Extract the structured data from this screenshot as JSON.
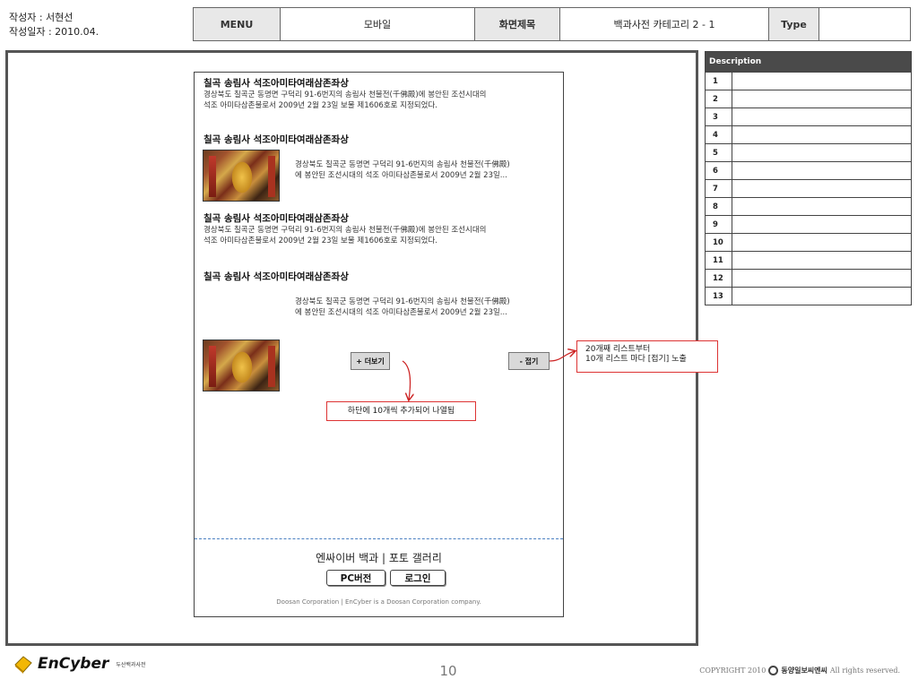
{
  "meta": {
    "author_line": "작성자 : 서현선",
    "date_line": "작성일자 : 2010.04."
  },
  "header": {
    "menu_label": "MENU",
    "menu_value": "모바일",
    "screen_title_label": "화면제목",
    "screen_title_value": "백과사전 카테고리 2 - 1",
    "type_label": "Type",
    "type_value": ""
  },
  "list": {
    "items": [
      {
        "title": "칠곡 송림사 석조아미타여래삼존좌상",
        "desc_line1": "경상북도 칠곡군 동명면 구덕리 91-6번지의 송림사 천불전(千佛殿)에 봉안된 조선시대의",
        "desc_line2": "석조 아미타삼존불로서 2009년 2월 23일 보물 제1606호로 지정되었다."
      },
      {
        "title": "칠곡 송림사 석조아미타여래삼존좌상",
        "desc_line1": "경상북도 칠곡군 동명면 구덕리 91-6번지의 송림사 천불전(千佛殿)",
        "desc_line2": "에 봉안된 조선시대의 석조 아미타삼존불로서 2009년 2월 23일..."
      },
      {
        "title": "칠곡 송림사 석조아미타여래삼존좌상",
        "desc_line1": "경상북도 칠곡군 동명면 구덕리 91-6번지의 송림사 천불전(千佛殿)에 봉안된 조선시대의",
        "desc_line2": "석조 아미타삼존불로서 2009년 2월 23일 보물 제1606호로 지정되었다."
      },
      {
        "title": "칠곡 송림사 석조아미타여래삼존좌상",
        "desc_line1": "경상북도 칠곡군 동명면 구덕리 91-6번지의 송림사 천불전(千佛殿)",
        "desc_line2": "에 봉안된 조선시대의 석조 아미타삼존불로서 2009년 2월 23일..."
      }
    ],
    "more_button": "+ 더보기",
    "fold_button": "- 접기"
  },
  "annotations": {
    "more_note": "하단에 10개씩 추가되어 나열됨",
    "fold_note_line1": "20개째 리스트부터",
    "fold_note_line2": "10개 리스트 마다 [접기] 노출"
  },
  "footer": {
    "links": "엔싸이버 백과 | 포토 갤러리",
    "pc_button": "PC버전",
    "login_button": "로그인",
    "company": "Doosan Corporation | EnCyber is a Doosan Corporation company."
  },
  "description": {
    "heading": "Description",
    "rows": [
      "1",
      "2",
      "3",
      "4",
      "5",
      "6",
      "7",
      "8",
      "9",
      "10",
      "11",
      "12",
      "13"
    ]
  },
  "bottom": {
    "brand": "EnCyber",
    "brand_sub": "두산백과사전",
    "page_number": "10",
    "copyright_prefix": "COPYRIGHT 2010",
    "copyright_company": "동양일보씨엔씨",
    "copyright_suffix": "All rights reserved."
  },
  "colors": {
    "callout_border": "#dd3333",
    "arrow": "#cc2222",
    "desc_header_bg": "#4a4a4a",
    "brand_icon": "#f2b705"
  }
}
